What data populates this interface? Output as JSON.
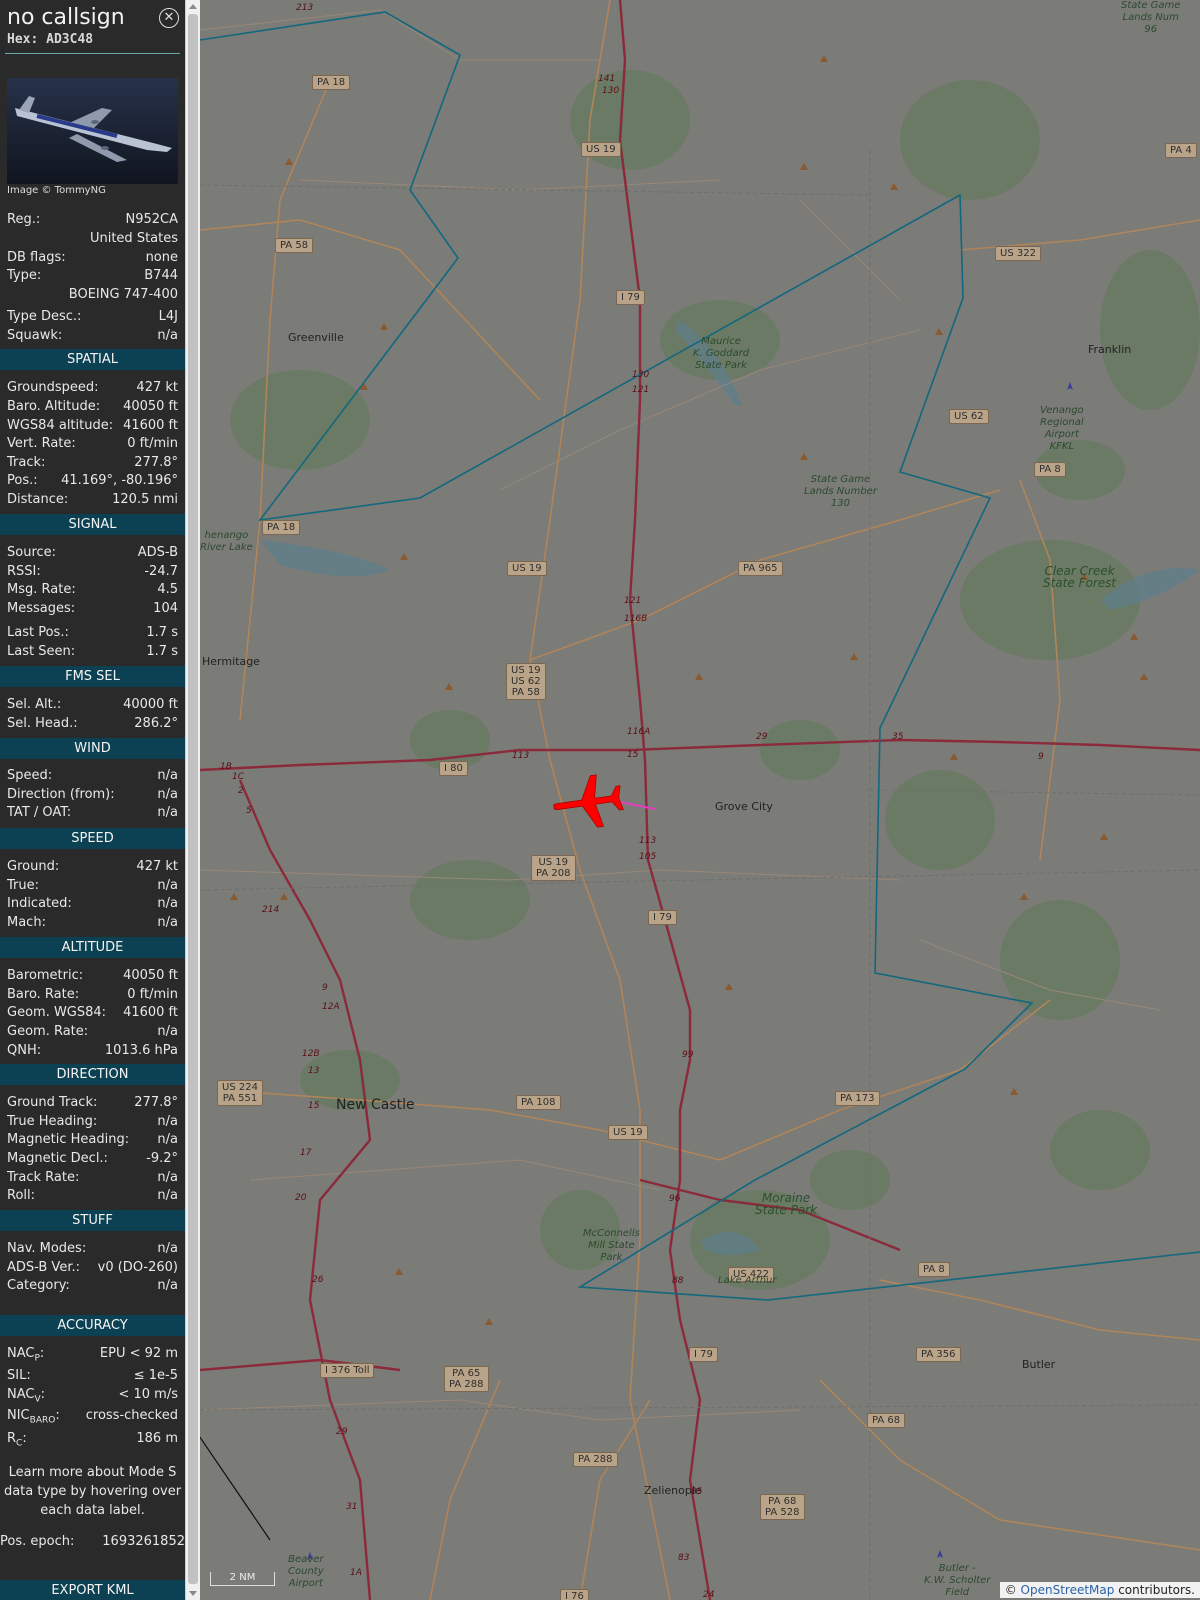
{
  "header": {
    "callsign": "no callsign",
    "hex_label": "Hex:",
    "hex_value": "AD3C48",
    "close_icon": "close-circle-icon",
    "image_credit": "Image © TommyNG"
  },
  "aircraft_info": [
    {
      "label": "Reg.:",
      "value": "N952CA"
    },
    {
      "label": "",
      "value": "United States"
    },
    {
      "label": "DB flags:",
      "value": "none"
    },
    {
      "label": "Type:",
      "value": "B744"
    },
    {
      "label": "",
      "value": "BOEING 747-400"
    },
    {
      "label": "Type Desc.:",
      "value": "L4J"
    },
    {
      "label": "Squawk:",
      "value": "n/a"
    }
  ],
  "sections": [
    {
      "title": "SPATIAL",
      "rows": [
        {
          "label": "Groundspeed:",
          "value": "427 kt"
        },
        {
          "label": "Baro. Altitude:",
          "value": "40050 ft"
        },
        {
          "label": "WGS84 altitude:",
          "value": "41600 ft"
        },
        {
          "label": "Vert. Rate:",
          "value": "0 ft/min"
        },
        {
          "label": "Track:",
          "value": "277.8°"
        },
        {
          "label": "Pos.:",
          "value": "41.169°, -80.196°"
        },
        {
          "label": "Distance:",
          "value": "120.5 nmi"
        }
      ]
    },
    {
      "title": "SIGNAL",
      "rows": [
        {
          "label": "Source:",
          "value": "ADS-B"
        },
        {
          "label": "RSSI:",
          "value": "-24.7"
        },
        {
          "label": "Msg. Rate:",
          "value": "4.5"
        },
        {
          "label": "Messages:",
          "value": "104"
        },
        {
          "label": "Last Pos.:",
          "value": "1.7 s"
        },
        {
          "label": "Last Seen:",
          "value": "1.7 s"
        }
      ]
    },
    {
      "title": "FMS SEL",
      "rows": [
        {
          "label": "Sel. Alt.:",
          "value": "40000 ft"
        },
        {
          "label": "Sel. Head.:",
          "value": "286.2°"
        }
      ]
    },
    {
      "title": "WIND",
      "rows": [
        {
          "label": "Speed:",
          "value": "n/a"
        },
        {
          "label": "Direction (from):",
          "value": "n/a"
        },
        {
          "label": "TAT / OAT:",
          "value": "n/a"
        }
      ]
    },
    {
      "title": "SPEED",
      "rows": [
        {
          "label": "Ground:",
          "value": "427 kt"
        },
        {
          "label": "True:",
          "value": "n/a"
        },
        {
          "label": "Indicated:",
          "value": "n/a"
        },
        {
          "label": "Mach:",
          "value": "n/a"
        }
      ]
    },
    {
      "title": "ALTITUDE",
      "rows": [
        {
          "label": "Barometric:",
          "value": "40050 ft"
        },
        {
          "label": "Baro. Rate:",
          "value": "0 ft/min"
        },
        {
          "label": "Geom. WGS84:",
          "value": "41600 ft"
        },
        {
          "label": "Geom. Rate:",
          "value": "n/a"
        },
        {
          "label": "QNH:",
          "value": "1013.6 hPa"
        }
      ]
    },
    {
      "title": "DIRECTION",
      "rows": [
        {
          "label": "Ground Track:",
          "value": "277.8°"
        },
        {
          "label": "True Heading:",
          "value": "n/a"
        },
        {
          "label": "Magnetic Heading:",
          "value": "n/a"
        },
        {
          "label": "Magnetic Decl.:",
          "value": "-9.2°"
        },
        {
          "label": "Track Rate:",
          "value": "n/a"
        },
        {
          "label": "Roll:",
          "value": "n/a"
        }
      ]
    },
    {
      "title": "STUFF",
      "rows": [
        {
          "label": "Nav. Modes:",
          "value": "n/a"
        },
        {
          "label": "ADS-B Ver.:",
          "value": "v0 (DO-260)"
        },
        {
          "label": "Category:",
          "value": "n/a"
        }
      ]
    },
    {
      "title": "ACCURACY",
      "rows": [
        {
          "label": "NAC",
          "sub": "P",
          "value": "EPU < 92 m"
        },
        {
          "label": "SIL:",
          "sub": "",
          "value": "≤ 1e-5"
        },
        {
          "label": "NAC",
          "sub": "V",
          "value": "< 10 m/s"
        },
        {
          "label": "NIC",
          "sub": "BARO",
          "value": "cross-checked"
        },
        {
          "label": "R",
          "sub": "C",
          "value": "186 m"
        }
      ]
    }
  ],
  "footer": {
    "learn_more": "Learn more about Mode S data type by hovering over each data label.",
    "pos_epoch_label": "Pos. epoch:",
    "pos_epoch_value": "1693261852",
    "export_kml": "EXPORT KML"
  },
  "map": {
    "towns": [
      {
        "name": "Greenville",
        "big": false
      },
      {
        "name": "Hermitage",
        "big": false
      },
      {
        "name": "Grove City",
        "big": false
      },
      {
        "name": "New Castle",
        "big": true
      },
      {
        "name": "Franklin",
        "big": false
      },
      {
        "name": "Butler",
        "big": false
      },
      {
        "name": "Zelienople",
        "big": false
      }
    ],
    "shields": [
      "PA 18",
      "US 19",
      "PA 58",
      "I 79",
      "US 322",
      "US 62",
      "PA 8",
      "PA 18",
      "US 19",
      "PA 965",
      "US 19\nUS 62\nPA 58",
      "I 80",
      "US 19\nPA 208",
      "I 79",
      "US 224\nPA 551",
      "PA 108",
      "US 19",
      "PA 173",
      "US 422",
      "PA 8",
      "I 79",
      "PA 356",
      "I 376 Toll",
      "PA 65\nPA 288",
      "PA 68",
      "PA 288",
      "PA 68\nPA 528",
      "PA 4",
      "I 76"
    ],
    "parks": [
      "Maurice\nK. Goddard\nState Park",
      "State Game\nLands Number\n130",
      "Venango\nRegional\nAirport\nKFKL",
      "Clear Creek\nState Forest",
      "Moraine\nState Park",
      "Lake Arthur",
      "McConnells\nMill State\nPark",
      "Beaver\nCounty\nAirport",
      "Butler -\nK.W. Scholter\nField",
      "henango\nRiver Lake",
      "State Game\nLands Num\n96"
    ],
    "exits": [
      "141",
      "130",
      "130",
      "121",
      "121",
      "116B",
      "116A",
      "15",
      "113",
      "113",
      "105",
      "99",
      "96",
      "88",
      "85",
      "83",
      "24",
      "29",
      "35",
      "9",
      "9",
      "12A",
      "12B",
      "13",
      "15",
      "17",
      "20",
      "26",
      "29",
      "31",
      "1A",
      "1B",
      "1C",
      "2",
      "5",
      "214",
      "213"
    ],
    "scale_label": "2 NM",
    "attribution_prefix": "©",
    "attribution_link": "OpenStreetMap",
    "attribution_suffix": "contributors.",
    "aircraft_icon": "airplane-icon",
    "airport_icon": "airport-icon",
    "colors": {
      "map_bg": "#7b7b77",
      "range_ring": "#12687f",
      "interstate": "#8b2a3a",
      "aircraft": "#ff0000",
      "track": "#e040c0",
      "sidebar_section": "#0b4152"
    }
  }
}
